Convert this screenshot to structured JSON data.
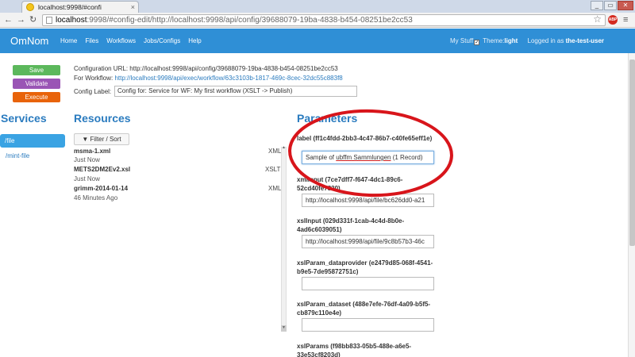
{
  "browser": {
    "tab_title": "localhost:9998/#confi",
    "tab_close": "×",
    "url_host": "localhost",
    "url_rest": ":9998/#config-edit/http://localhost:9998/api/config/39688079-19ba-4838-b454-08251be2cc53",
    "abp_label": "ABP",
    "back": "←",
    "forward": "→",
    "reload": "↻",
    "star": "☆",
    "menu": "≡",
    "win_min": "_",
    "win_max": "▭",
    "win_close": "✕"
  },
  "navbar": {
    "brand": "OmNom",
    "links": [
      "Home",
      "Files",
      "Workflows",
      "Jobs/Configs",
      "Help"
    ],
    "my_stuff": "My Stuff",
    "checkmark": "✓",
    "theme_label": "Theme:",
    "theme_value": "light",
    "logged_in_label": "Logged in as",
    "user": "the-test-user"
  },
  "actions": {
    "save": "Save",
    "validate": "Validate",
    "execute": "Execute"
  },
  "config": {
    "url_label": "Configuration URL:",
    "url": "http://localhost:9998/api/config/39688079-19ba-4838-b454-08251be2cc53",
    "workflow_label": "For Workflow:",
    "workflow_url": "http://localhost:9998/api/exec/workflow/63c3103b-1817-469c-8cec-32dc55c883f8",
    "label_label": "Config Label:",
    "label_value": "Config for: Service for WF: My first workflow (XSLT -> Publish)"
  },
  "services": {
    "heading": "Services",
    "items": [
      "/file",
      "/mint-file"
    ]
  },
  "resources": {
    "heading": "Resources",
    "filter_button": "Filter / Sort",
    "items": [
      {
        "name": "msma-1.xml",
        "time": "Just Now",
        "type": "XML"
      },
      {
        "name": "METS2DM2Ev2.xsl",
        "time": "Just Now",
        "type": "XSLT"
      },
      {
        "name": "grimm-2014-01-14",
        "time": "46 Minutes Ago",
        "type": "XML"
      }
    ],
    "scroll_up": "▲",
    "scroll_down": "▼"
  },
  "parameters": {
    "heading": "Parameters",
    "items": [
      {
        "label": "label (ff1c4fdd-2bb3-4c47-86b7-c40fe65eff1e)",
        "value_prefix": "Sample of ",
        "value_underlined": "ubffm Sammlungen",
        "value_suffix": " (1 Record)"
      },
      {
        "label": "xmlInput (7ce7dff7-f647-4dc1-89c6-52cd40fe7820)",
        "value": "http://localhost:9998/api/file/bc626dd0-a21"
      },
      {
        "label": "xslInput (029d331f-1cab-4c4d-8b0e-4ad6c6039051)",
        "value": "http://localhost:9998/api/file/9c8b57b3-46c"
      },
      {
        "label": "xslParam_dataprovider (e2479d85-068f-4541-b9e5-7de95872751c)",
        "value": ""
      },
      {
        "label": "xslParam_dataset (488e7efe-76df-4a09-b5f5-cb879c110e4e)",
        "value": ""
      },
      {
        "label": "xslParams (f98bb833-05b5-488e-a6e5-33e53cf8203d)",
        "value": ""
      }
    ]
  },
  "colors": {
    "navbar": "#2f8fd6",
    "save": "#5cb85c",
    "validate": "#9a55b5",
    "execute": "#e8630a",
    "link": "#2a7bbf",
    "annotation": "#d8151b"
  }
}
